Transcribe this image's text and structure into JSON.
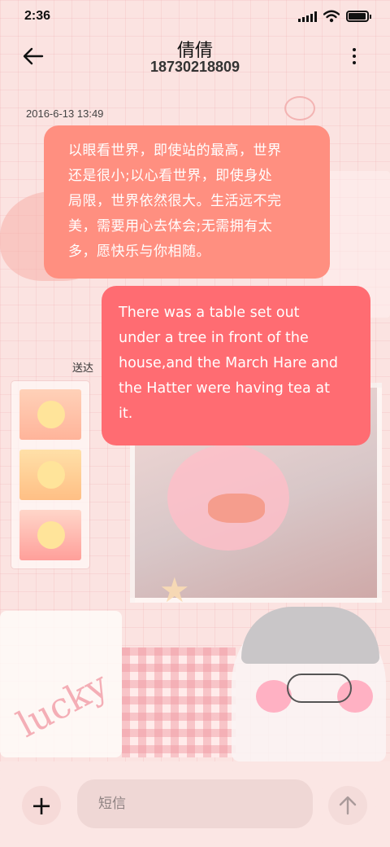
{
  "status_bar": {
    "time": "2:36",
    "icons": [
      "signal-icon",
      "wifi-icon",
      "battery-icon"
    ],
    "battery_level": 0.95
  },
  "header": {
    "back_icon": "arrow-left-icon",
    "contact_name": "倩倩",
    "contact_number": "18730218809",
    "more_icon": "more-vertical-icon"
  },
  "conversation": {
    "timestamp": "2016-6-13 13:49",
    "messages": [
      {
        "direction": "incoming",
        "lines": [
          "以眼看世界，即使站的最高，世界",
          "还是很小;以心看世界，即使身处",
          "局限，世界依然很大。生活远不完",
          "美，需要用心去体会;无需拥有太",
          "多，愿快乐与你相随。"
        ]
      },
      {
        "direction": "outgoing",
        "lines": [
          "There was a table set out",
          "under a tree in front of the",
          "house,and the March Hare and",
          "the Hatter were having tea at",
          "it."
        ],
        "status": "送达"
      }
    ]
  },
  "composer": {
    "add_icon": "plus-icon",
    "placeholder": "短信",
    "send_icon": "arrow-up-icon"
  },
  "colors": {
    "incoming_bubble": "#ff8f80",
    "outgoing_bubble": "#ff6c72",
    "background": "#fbe3e1"
  }
}
